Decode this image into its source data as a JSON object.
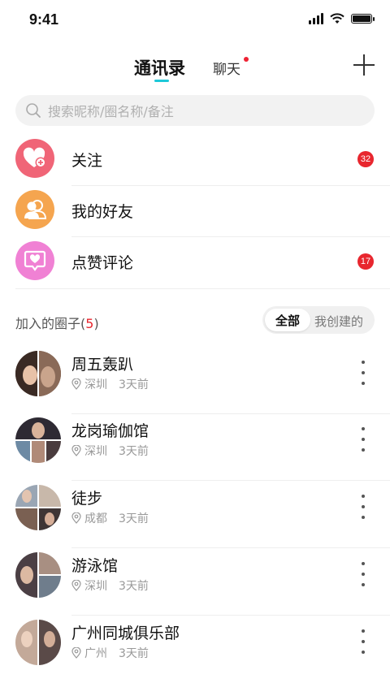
{
  "status_bar": {
    "time": "9:41"
  },
  "header": {
    "tab_contacts": "通讯录",
    "tab_chat": "聊天",
    "accent": "#1ec8d8"
  },
  "search": {
    "placeholder": "搜索昵称/圈名称/备注"
  },
  "quick_items": [
    {
      "label": "关注",
      "badge": "32",
      "color": "#f06577",
      "icon": "heart-plus-icon"
    },
    {
      "label": "我的好友",
      "badge": "",
      "color": "#f5a54f",
      "icon": "friends-icon"
    },
    {
      "label": "点赞评论",
      "badge": "17",
      "color": "#f081d4",
      "icon": "heart-comment-icon"
    }
  ],
  "circles": {
    "title": "加入的圈子",
    "count": "5",
    "filter_all": "全部",
    "filter_mine": "我创建的",
    "items": [
      {
        "name": "周五轰趴",
        "location": "深圳",
        "ago": "3天前"
      },
      {
        "name": "龙岗瑜伽馆",
        "location": "深圳",
        "ago": "3天前"
      },
      {
        "name": "徒步",
        "location": "成都",
        "ago": "3天前"
      },
      {
        "name": "游泳馆",
        "location": "深圳",
        "ago": "3天前"
      },
      {
        "name": "广州同城俱乐部",
        "location": "广州",
        "ago": "3天前"
      }
    ]
  }
}
